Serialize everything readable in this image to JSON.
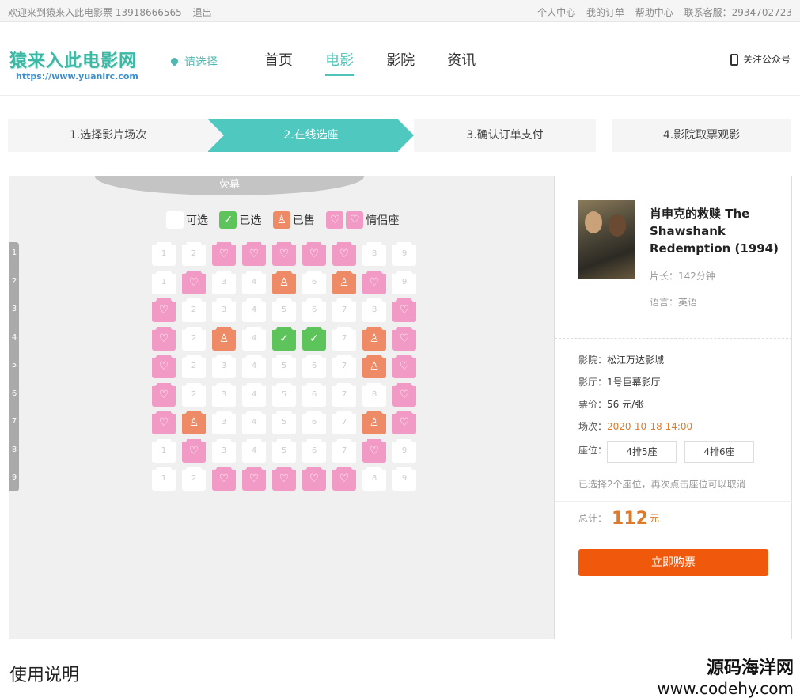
{
  "topbar": {
    "welcome": "欢迎来到猿来入此电影票 13918666565",
    "logout": "退出",
    "links": [
      "个人中心",
      "我的订单",
      "帮助中心",
      "联系客服：2934702723"
    ]
  },
  "header": {
    "logo_text": "猿来入此电影网",
    "logo_url": "https://www.yuanlrc.com",
    "location": "请选择",
    "nav": [
      "首页",
      "电影",
      "影院",
      "资讯"
    ],
    "follow": "关注公众号"
  },
  "steps": [
    "1.选择影片场次",
    "2.在线选座",
    "3.确认订单支付",
    "4.影院取票观影"
  ],
  "seat_map": {
    "screen_label": "荧幕",
    "legend": {
      "free": "可选",
      "selected": "已选",
      "sold": "已售",
      "love": "情侣座"
    },
    "rows": [
      "1",
      "2",
      "3",
      "4",
      "5",
      "6",
      "7",
      "8",
      "9"
    ],
    "seats": [
      [
        "f",
        "f",
        "l",
        "l",
        "l",
        "l",
        "l",
        "f",
        "f"
      ],
      [
        "f",
        "l",
        "f",
        "f",
        "s",
        "f",
        "s",
        "l",
        "f"
      ],
      [
        "l",
        "f",
        "f",
        "f",
        "f",
        "f",
        "f",
        "f",
        "l"
      ],
      [
        "l",
        "f",
        "s",
        "f",
        "c",
        "c",
        "f",
        "s",
        "l"
      ],
      [
        "l",
        "f",
        "f",
        "f",
        "f",
        "f",
        "f",
        "s",
        "l"
      ],
      [
        "l",
        "f",
        "f",
        "f",
        "f",
        "f",
        "f",
        "f",
        "l"
      ],
      [
        "l",
        "s",
        "f",
        "f",
        "f",
        "f",
        "f",
        "s",
        "l"
      ],
      [
        "f",
        "l",
        "f",
        "f",
        "f",
        "f",
        "f",
        "l",
        "f"
      ],
      [
        "f",
        "f",
        "l",
        "l",
        "l",
        "l",
        "l",
        "f",
        "f"
      ]
    ],
    "colors": {
      "love": "#f29ac6",
      "sold": "#ee8a65",
      "selected": "#5cc45a",
      "free": "#ffffff"
    }
  },
  "movie": {
    "title": "肖申克的救赎 The Shawshank Redemption (1994)",
    "duration": "片长：142分钟",
    "language": "语言：英语"
  },
  "order": {
    "cinema_label": "影院：",
    "cinema": "松江万达影城",
    "hall_label": "影厅：",
    "hall": "1号巨幕影厅",
    "price_label": "票价：",
    "price": "56 元/张",
    "time_label": "场次：",
    "time": "2020-10-18 14:00",
    "seat_label": "座位：",
    "tickets": [
      "4排5座",
      "4排6座"
    ],
    "hint": "已选择2个座位，再次点击座位可以取消",
    "total_label": "总计：",
    "total": "112",
    "total_unit": "元",
    "buy_label": "立即购票"
  },
  "usage_title": "使用说明",
  "watermark": {
    "line1": "源码海洋网",
    "line2": "www.codehy.com"
  }
}
